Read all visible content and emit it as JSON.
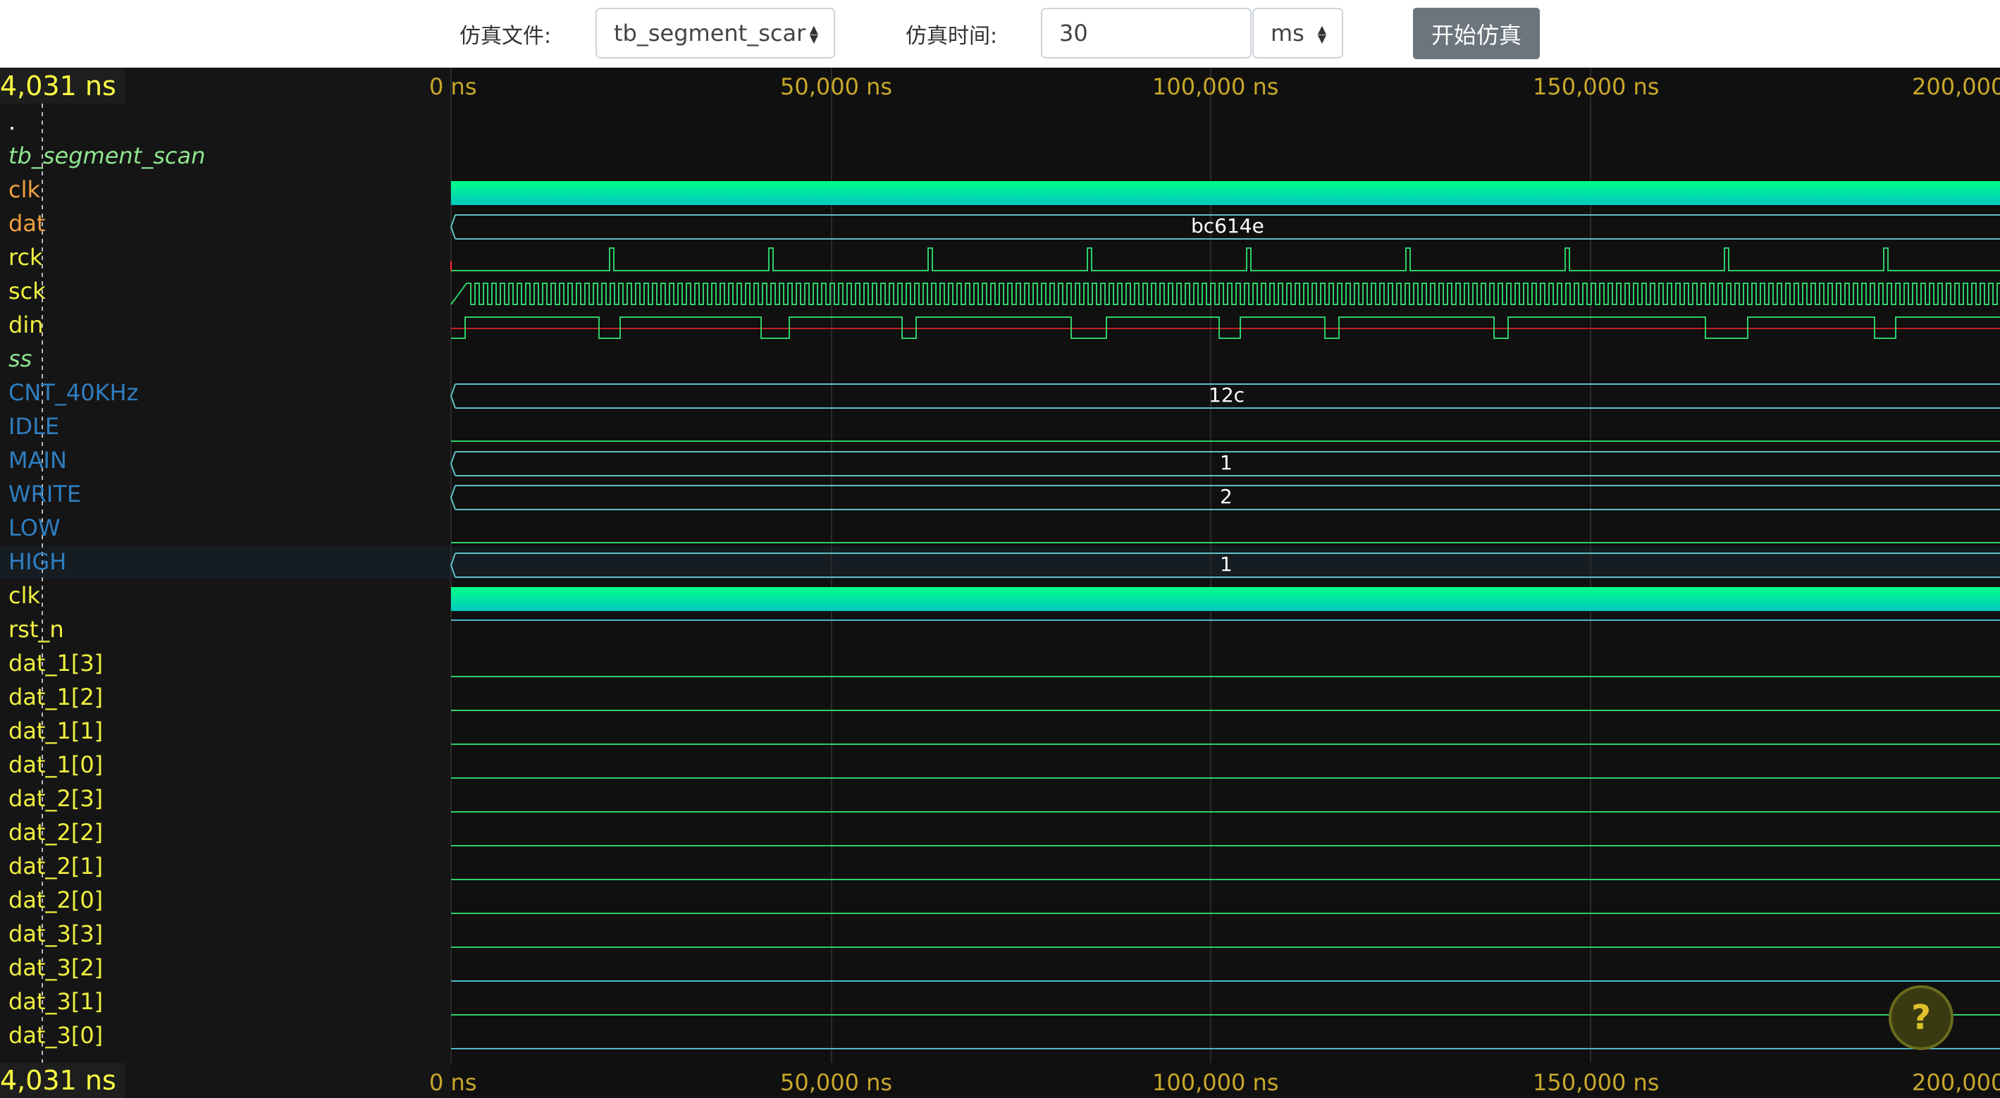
{
  "toolbar": {
    "file_label": "仿真文件:",
    "file_value": "tb_segment_scar",
    "time_label": "仿真时间:",
    "time_value": "30",
    "unit_value": "ms",
    "start_label": "开始仿真"
  },
  "cursor_time": "4,031 ns",
  "ruler_ticks": [
    "0 ns",
    "50,000 ns",
    "100,000 ns",
    "150,000 ns",
    "200,000"
  ],
  "signals": [
    {
      "name": ".",
      "color": "white"
    },
    {
      "name": "tb_segment_scan",
      "color": "green"
    },
    {
      "name": "clk",
      "color": "orange"
    },
    {
      "name": "dat",
      "color": "orange"
    },
    {
      "name": "rck",
      "color": "yellow"
    },
    {
      "name": "sck",
      "color": "yellow"
    },
    {
      "name": "din",
      "color": "yellow"
    },
    {
      "name": "ss",
      "color": "green"
    },
    {
      "name": "CNT_40KHz",
      "color": "blue"
    },
    {
      "name": "IDLE",
      "color": "blue"
    },
    {
      "name": "MAIN",
      "color": "blue"
    },
    {
      "name": "WRITE",
      "color": "blue"
    },
    {
      "name": "LOW",
      "color": "blue"
    },
    {
      "name": "HIGH",
      "color": "blue"
    },
    {
      "name": "clk",
      "color": "yellow"
    },
    {
      "name": "rst_n",
      "color": "yellow"
    },
    {
      "name": "dat_1[3]",
      "color": "yellow"
    },
    {
      "name": "dat_1[2]",
      "color": "yellow"
    },
    {
      "name": "dat_1[1]",
      "color": "yellow"
    },
    {
      "name": "dat_1[0]",
      "color": "yellow"
    },
    {
      "name": "dat_2[3]",
      "color": "yellow"
    },
    {
      "name": "dat_2[2]",
      "color": "yellow"
    },
    {
      "name": "dat_2[1]",
      "color": "yellow"
    },
    {
      "name": "dat_2[0]",
      "color": "yellow"
    },
    {
      "name": "dat_3[3]",
      "color": "yellow"
    },
    {
      "name": "dat_3[2]",
      "color": "yellow"
    },
    {
      "name": "dat_3[1]",
      "color": "yellow"
    },
    {
      "name": "dat_3[0]",
      "color": "yellow"
    }
  ],
  "bus_values": {
    "dat": "bc614e",
    "CNT_40KHz": "12c",
    "MAIN": "1",
    "WRITE": "2",
    "HIGH": "1"
  },
  "help_icon": "question-icon"
}
